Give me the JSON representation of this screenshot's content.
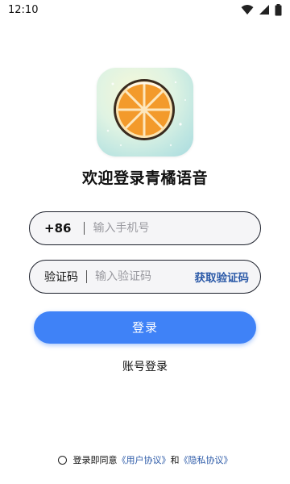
{
  "status_bar": {
    "time": "12:10",
    "icons": [
      "wifi-icon",
      "cellular-signal-icon",
      "battery-icon"
    ]
  },
  "app": {
    "logo_icon": "orange-slice-logo",
    "title": "欢迎登录青橘语音"
  },
  "phone_field": {
    "country_code": "+86",
    "placeholder": "输入手机号",
    "value": ""
  },
  "code_field": {
    "label": "验证码",
    "placeholder": "输入验证码",
    "value": "",
    "get_code_label": "获取验证码"
  },
  "login_button": {
    "label": "登录"
  },
  "account_login": {
    "label": "账号登录"
  },
  "agreement": {
    "checked": false,
    "prefix": "登录即同意",
    "user_agreement": "《用户协议》",
    "conjunction": "和",
    "privacy_policy": "《隐私协议》"
  },
  "colors": {
    "primary_button": "#3f82f7",
    "link": "#2c5aa8",
    "field_border": "#1b1f2a",
    "field_background": "#f5f5f7",
    "orange": "#f39a2b"
  }
}
